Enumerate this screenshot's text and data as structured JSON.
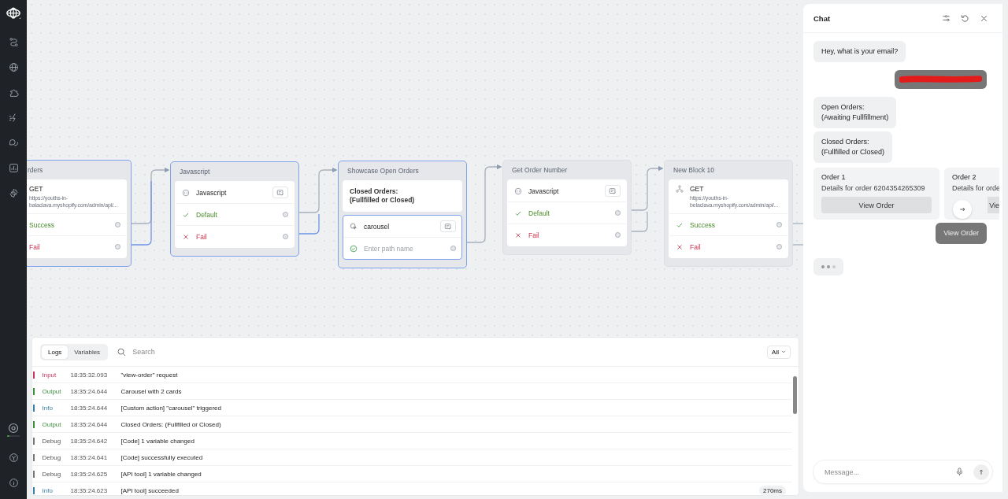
{
  "nodes": [
    {
      "title": "rders",
      "selected": true,
      "cut_left": true,
      "blocks": [
        {
          "selected": false,
          "rows": [
            {
              "kind": "request",
              "label": "GET",
              "detail": "https://youths-in-balaclava.myshopify.com/admin/api/..."
            },
            {
              "kind": "success",
              "label": "Success"
            },
            {
              "kind": "fail",
              "label": "Fail"
            }
          ]
        }
      ]
    },
    {
      "title": "Javascript",
      "selected": true,
      "cut_left": false,
      "blocks": [
        {
          "selected": false,
          "rows": [
            {
              "kind": "script",
              "label": "Javascript"
            },
            {
              "kind": "success",
              "label": "Default"
            },
            {
              "kind": "fail",
              "label": "Fail"
            }
          ]
        }
      ]
    },
    {
      "title": "Showcase Open Orders",
      "selected": true,
      "cut_left": false,
      "blocks": [
        {
          "selected": false,
          "rows": [
            {
              "kind": "message",
              "label": "Closed Orders:\n(Fullfilled or Closed)"
            }
          ]
        },
        {
          "selected": true,
          "rows": [
            {
              "kind": "carousel",
              "label": "carousel"
            },
            {
              "kind": "path",
              "placeholder": "Enter path name"
            }
          ]
        }
      ]
    },
    {
      "title": "Get Order Number",
      "selected": false,
      "cut_left": false,
      "blocks": [
        {
          "selected": false,
          "rows": [
            {
              "kind": "script",
              "label": "Javascript"
            },
            {
              "kind": "success",
              "label": "Default"
            },
            {
              "kind": "fail",
              "label": "Fail"
            }
          ]
        }
      ]
    },
    {
      "title": "New Block 10",
      "selected": false,
      "cut_left": false,
      "blocks": [
        {
          "selected": false,
          "rows": [
            {
              "kind": "request",
              "label": "GET",
              "detail": "https://youths-in-belaclava.myshopify.com/admin/api/..."
            },
            {
              "kind": "success",
              "label": "Success"
            },
            {
              "kind": "fail",
              "label": "Fail"
            }
          ]
        }
      ]
    }
  ],
  "logs": {
    "tabs": [
      {
        "label": "Logs",
        "selected": true
      },
      {
        "label": "Variables",
        "selected": false
      }
    ],
    "search": {
      "placeholder": "Search"
    },
    "filter": "All",
    "rows": [
      {
        "kind": "input",
        "level": "Input",
        "time": "18:35:32.093",
        "message": "\"view-order\" request"
      },
      {
        "kind": "output",
        "level": "Output",
        "time": "18:35:24.644",
        "message": "Carousel with 2 cards"
      },
      {
        "kind": "info",
        "level": "Info",
        "time": "18:35:24.644",
        "message": "[Custom action] \"carousel\" triggered"
      },
      {
        "kind": "output",
        "level": "Output",
        "time": "18:35:24.644",
        "message": "Closed Orders: (Fullfilled or Closed)"
      },
      {
        "kind": "debug",
        "level": "Debug",
        "time": "18:35:24.642",
        "message": "[Code] 1 variable changed"
      },
      {
        "kind": "debug",
        "level": "Debug",
        "time": "18:35:24.641",
        "message": "[Code] successfully executed"
      },
      {
        "kind": "debug",
        "level": "Debug",
        "time": "18:35:24.625",
        "message": "[API tool] 1 variable changed"
      },
      {
        "kind": "info",
        "level": "Info",
        "time": "18:35:24.623",
        "message": "[API tool] succeeded",
        "duration": "270ms"
      }
    ]
  },
  "chat": {
    "title": "Chat",
    "messages": [
      {
        "kind": "bot",
        "text": "Hey, what is your email?"
      },
      {
        "kind": "redacted"
      },
      {
        "kind": "bot",
        "text": "Open Orders:\n(Awaiting Fullfillment)"
      },
      {
        "kind": "bot",
        "text": "Closed Orders:\n(Fullfilled or Closed)"
      },
      {
        "kind": "carousel",
        "cards": [
          {
            "title": "Order 1",
            "detail": "Details for order 6204354265309",
            "button": "View Order"
          },
          {
            "title": "Order 2",
            "detail": "Details for orde",
            "button": "Vie"
          }
        ]
      },
      {
        "kind": "user",
        "text": "View Order"
      },
      {
        "kind": "typing"
      }
    ],
    "input": {
      "placeholder": "Message..."
    }
  }
}
